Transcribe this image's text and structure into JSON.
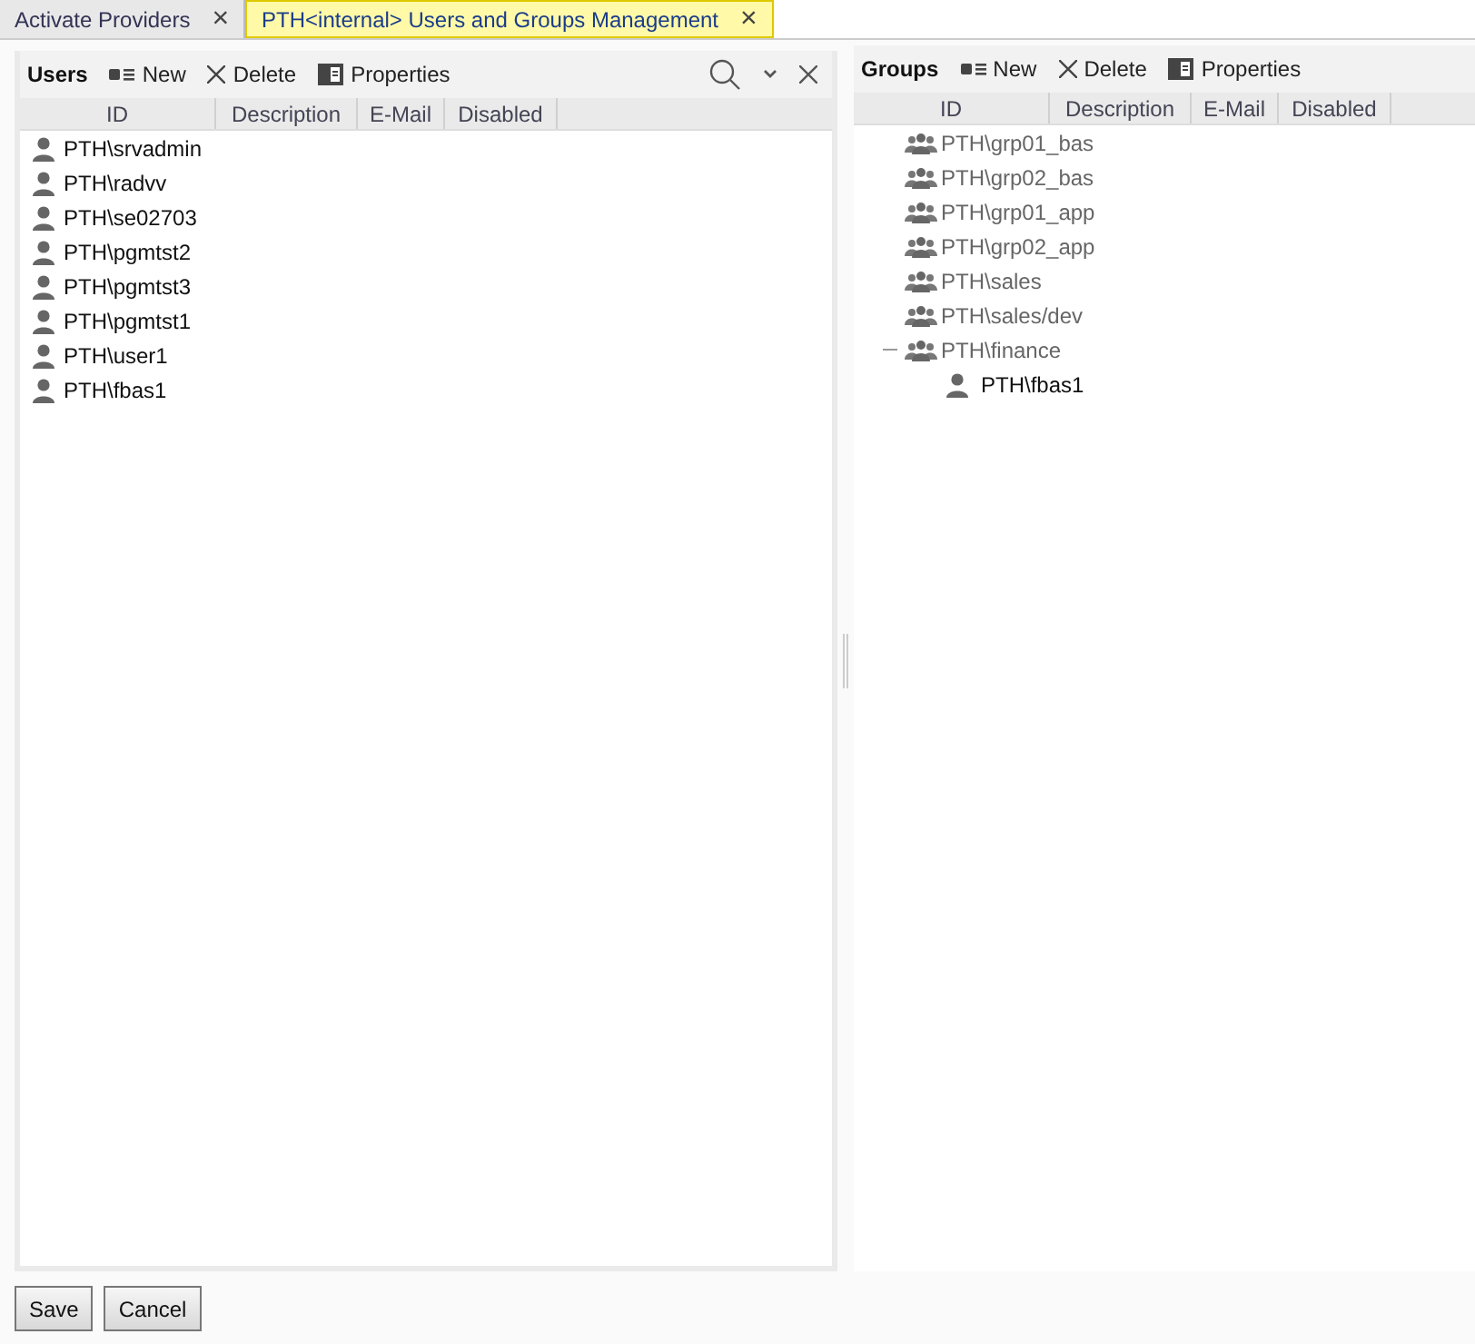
{
  "tabs": [
    {
      "label": "Activate Providers",
      "selected": false,
      "close": "×"
    },
    {
      "label": "PTH<internal> Users and Groups Management",
      "selected": true,
      "close": "×"
    }
  ],
  "users": {
    "title": "Users",
    "toolbar": [
      "New",
      "Delete",
      "Properties"
    ],
    "columns": [
      "ID",
      "Description",
      "E-Mail",
      "Disabled"
    ],
    "rows": [
      "PTH\\srvadmin",
      "PTH\\radvv",
      "PTH\\se02703",
      "PTH\\pgmtst2",
      "PTH\\pgmtst3",
      "PTH\\pgmtst1",
      "PTH\\user1",
      "PTH\\fbas1"
    ]
  },
  "groups": {
    "title": "Groups",
    "toolbar": [
      "New",
      "Delete",
      "Properties"
    ],
    "columns": [
      "ID",
      "Description",
      "E-Mail",
      "Disabled"
    ],
    "tree": [
      {
        "label": "PTH\\grp01_bas",
        "kind": "group"
      },
      {
        "label": "PTH\\grp02_bas",
        "kind": "group"
      },
      {
        "label": "PTH\\grp01_app",
        "kind": "group"
      },
      {
        "label": "PTH\\grp02_app",
        "kind": "group"
      },
      {
        "label": "PTH\\sales",
        "kind": "group"
      },
      {
        "label": "PTH\\sales/dev",
        "kind": "group"
      },
      {
        "label": "PTH\\finance",
        "kind": "group",
        "expanded": true,
        "children": [
          {
            "label": "PTH\\fbas1",
            "kind": "user"
          }
        ]
      }
    ]
  },
  "buttons": [
    "Save",
    "Cancel"
  ]
}
